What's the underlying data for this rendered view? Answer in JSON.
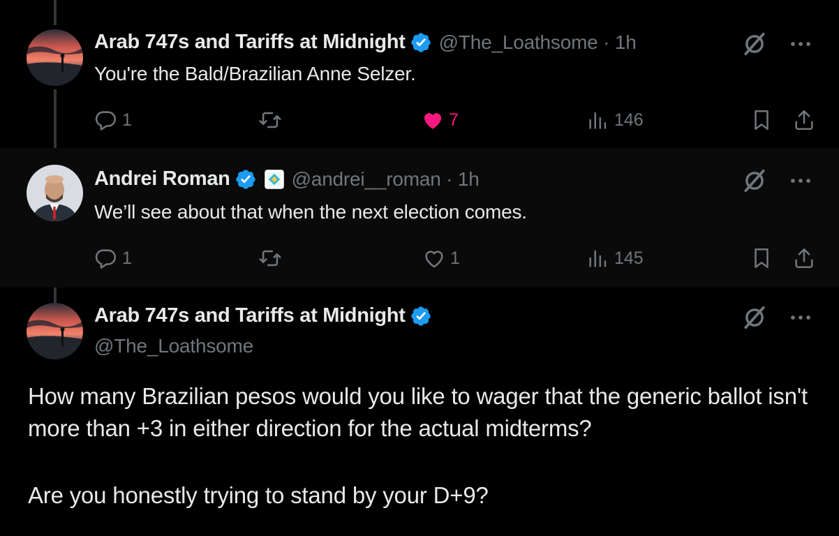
{
  "tweets": [
    {
      "display_name": "Arab 747s and Tariffs at Midnight",
      "handle": "@The_Loathsome",
      "time": "1h",
      "text": "You're the Bald/Brazilian Anne Selzer.",
      "replies": "1",
      "retweets": "",
      "likes": "7",
      "liked": true,
      "views": "146"
    },
    {
      "display_name": "Andrei Roman",
      "handle": "@andrei__roman",
      "time": "1h",
      "text": "We’ll see about that when the next election comes.",
      "replies": "1",
      "retweets": "",
      "likes": "1",
      "liked": false,
      "views": "145"
    }
  ],
  "main_tweet": {
    "display_name": "Arab 747s and Tariffs at Midnight",
    "handle": "@The_Loathsome",
    "paragraph1": "How many Brazilian pesos would you like to wager that the generic ballot isn't more than +3 in either direction for the actual midterms?",
    "paragraph2": "Are you honestly trying to stand by your D+9?"
  },
  "separator": "·",
  "icons": {
    "verified": "verified-badge-icon",
    "grok": "grok-icon",
    "more": "more-icon",
    "reply": "reply-icon",
    "retweet": "retweet-icon",
    "like": "heart-icon",
    "views": "views-icon",
    "bookmark": "bookmark-icon",
    "share": "share-icon"
  },
  "colors": {
    "background": "#000000",
    "highlight_background": "#0a0a0a",
    "text": "#e7e9ea",
    "secondary": "#71767b",
    "verified_blue": "#1d9bf0",
    "like_pink": "#f91880"
  }
}
